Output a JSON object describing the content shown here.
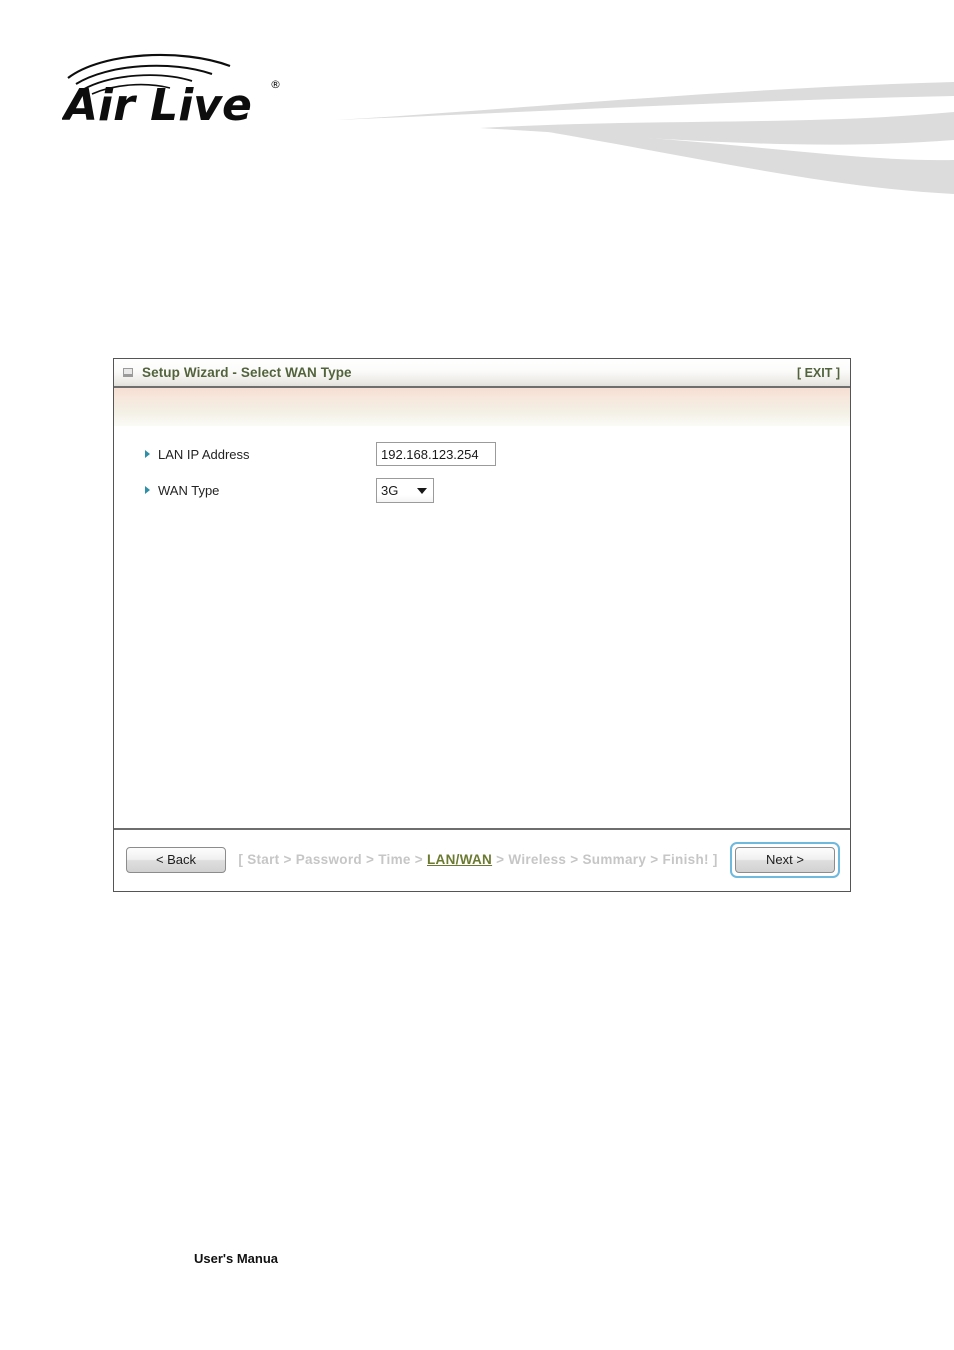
{
  "brand": {
    "logo_text": "Air Live",
    "logo_icon": "airlive-logo",
    "trademark": "®",
    "swoosh_icon": "swoosh-decoration"
  },
  "panel": {
    "titlebar": {
      "icon": "window-box-icon",
      "title": "Setup Wizard - Select WAN Type",
      "exit_label": "[ EXIT ]"
    },
    "fields": [
      {
        "name": "lan-ip-address",
        "label": "LAN IP Address",
        "control": "text",
        "value": "192.168.123.254",
        "placeholder": ""
      },
      {
        "name": "wan-type",
        "label": "WAN Type",
        "control": "select",
        "value": "3G",
        "caret_icon": "chevron-down-icon"
      }
    ],
    "footer": {
      "back_label": "< Back",
      "next_label": "Next >",
      "breadcrumb": {
        "open_bracket": "[ ",
        "close_bracket": " ]",
        "separator": " > ",
        "steps": [
          {
            "label": "Start",
            "active": false
          },
          {
            "label": "Password",
            "active": false
          },
          {
            "label": "Time",
            "active": false
          },
          {
            "label": "LAN/WAN",
            "active": true
          },
          {
            "label": "Wireless",
            "active": false
          },
          {
            "label": "Summary",
            "active": false
          },
          {
            "label": "Finish!",
            "active": false
          }
        ]
      }
    }
  },
  "document": {
    "footer_text": "User's Manua"
  },
  "colors": {
    "title_green": "#52633c",
    "crumb_active": "#6b7a30",
    "crumb_inactive": "#c6c6c6",
    "bullet_blue": "#2f8ea8",
    "focus_blue": "#6fb8de",
    "swoosh_gray": "#dcdcdc"
  }
}
